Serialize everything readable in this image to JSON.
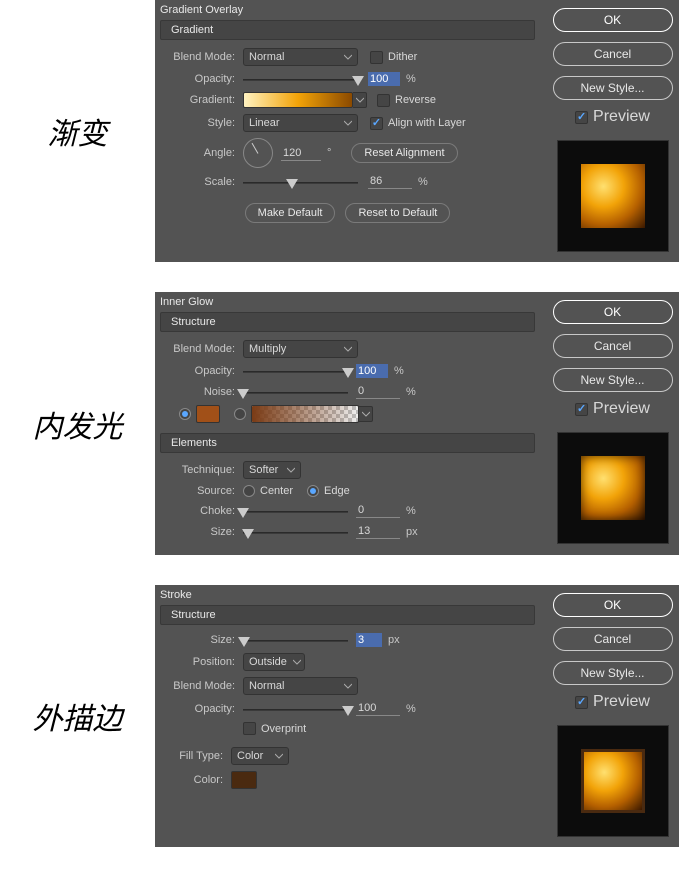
{
  "cn_labels": {
    "gradient": "渐变",
    "inner_glow": "内发光",
    "stroke": "外描边"
  },
  "sidebar": {
    "ok": "OK",
    "cancel": "Cancel",
    "new_style": "New Style...",
    "preview": "Preview"
  },
  "gradient_overlay": {
    "title": "Gradient Overlay",
    "section": "Gradient",
    "blend_mode_label": "Blend Mode:",
    "blend_mode": "Normal",
    "dither_label": "Dither",
    "dither": false,
    "opacity_label": "Opacity:",
    "opacity": "100",
    "opacity_unit": "%",
    "gradient_label": "Gradient:",
    "gradient_stops": [
      "#fff2c0",
      "#f2a308",
      "#8b4a00"
    ],
    "reverse_label": "Reverse",
    "reverse": false,
    "style_label": "Style:",
    "style": "Linear",
    "align_label": "Align with Layer",
    "align": true,
    "angle_label": "Angle:",
    "angle": "120",
    "angle_unit": "°",
    "reset_alignment": "Reset Alignment",
    "scale_label": "Scale:",
    "scale": "86",
    "scale_unit": "%",
    "make_default": "Make Default",
    "reset_default": "Reset to Default"
  },
  "inner_glow": {
    "title": "Inner Glow",
    "structure": "Structure",
    "blend_mode_label": "Blend Mode:",
    "blend_mode": "Multiply",
    "opacity_label": "Opacity:",
    "opacity": "100",
    "opacity_unit": "%",
    "noise_label": "Noise:",
    "noise": "0",
    "noise_unit": "%",
    "solid_color": "#a15018",
    "elements": "Elements",
    "technique_label": "Technique:",
    "technique": "Softer",
    "source_label": "Source:",
    "center": "Center",
    "edge": "Edge",
    "source_value": "edge",
    "choke_label": "Choke:",
    "choke": "0",
    "choke_unit": "%",
    "size_label": "Size:",
    "size": "13",
    "size_unit": "px"
  },
  "stroke": {
    "title": "Stroke",
    "structure": "Structure",
    "size_label": "Size:",
    "size": "3",
    "size_unit": "px",
    "position_label": "Position:",
    "position": "Outside",
    "blend_mode_label": "Blend Mode:",
    "blend_mode": "Normal",
    "opacity_label": "Opacity:",
    "opacity": "100",
    "opacity_unit": "%",
    "overprint_label": "Overprint",
    "overprint": false,
    "fill_type_label": "Fill Type:",
    "fill_type": "Color",
    "color_label": "Color:",
    "color": "#4a2a10"
  },
  "preview_gradient": "radial-gradient(circle at 35% 35%, #ffe070 0%, #f2a308 35%, #b56000 65%, #3a1800 100%)"
}
